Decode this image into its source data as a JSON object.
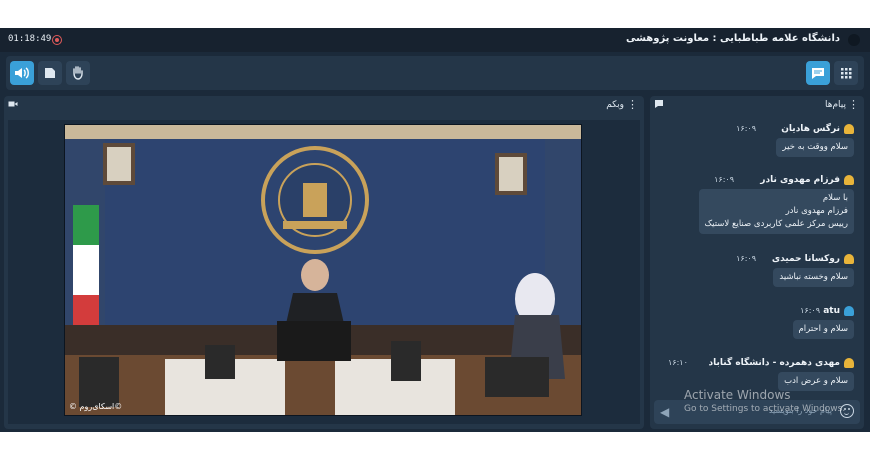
{
  "header": {
    "time": "01:18:49",
    "title": "دانشگاه علامه طباطبایی : معاونت پژوهشی"
  },
  "toolbar": {
    "left_icons": [
      "speaker-icon",
      "screen-share-icon",
      "raise-hand-icon"
    ],
    "right_icons": [
      "chat-icon",
      "apps-grid-icon"
    ],
    "accent": "#3aa0d8"
  },
  "webcam": {
    "title": "وبکم",
    "watermark": "©اسکای‌روم ©"
  },
  "chat": {
    "title": "پیام‌ها",
    "messages": [
      {
        "name": "نرگس هادیان",
        "time": "۱۶:۰۹",
        "lines": [
          "سلام ووقت به خیر"
        ],
        "icon_color": "#e8b43a"
      },
      {
        "name": "فرزام مهدوی نادر",
        "time": "۱۶:۰۹",
        "lines": [
          "با سلام",
          "فرزام مهدوی نادر",
          "رییس مرکز علمی کاربردی صنایع لاستیک"
        ],
        "icon_color": "#e8b43a"
      },
      {
        "name": "روکسانا حمیدی",
        "time": "۱۶:۰۹",
        "lines": [
          "سلام وخسته نباشید"
        ],
        "icon_color": "#e8b43a"
      },
      {
        "name": "atu",
        "time": "۱۶:۰۹",
        "lines": [
          "سلام و احترام"
        ],
        "icon_color": "#3aa0d8"
      },
      {
        "name": "مهدی دهمرده - دانشگاه گناباد",
        "time": "۱۶:۱۰",
        "lines": [
          "سلام و عرض ادب"
        ],
        "icon_color": "#e8b43a"
      }
    ],
    "input_placeholder": "پیام خود را بنویسید"
  },
  "overlay": {
    "activation_title": "Activate Windows",
    "activation_sub": "Go to Settings to activate Windows."
  }
}
